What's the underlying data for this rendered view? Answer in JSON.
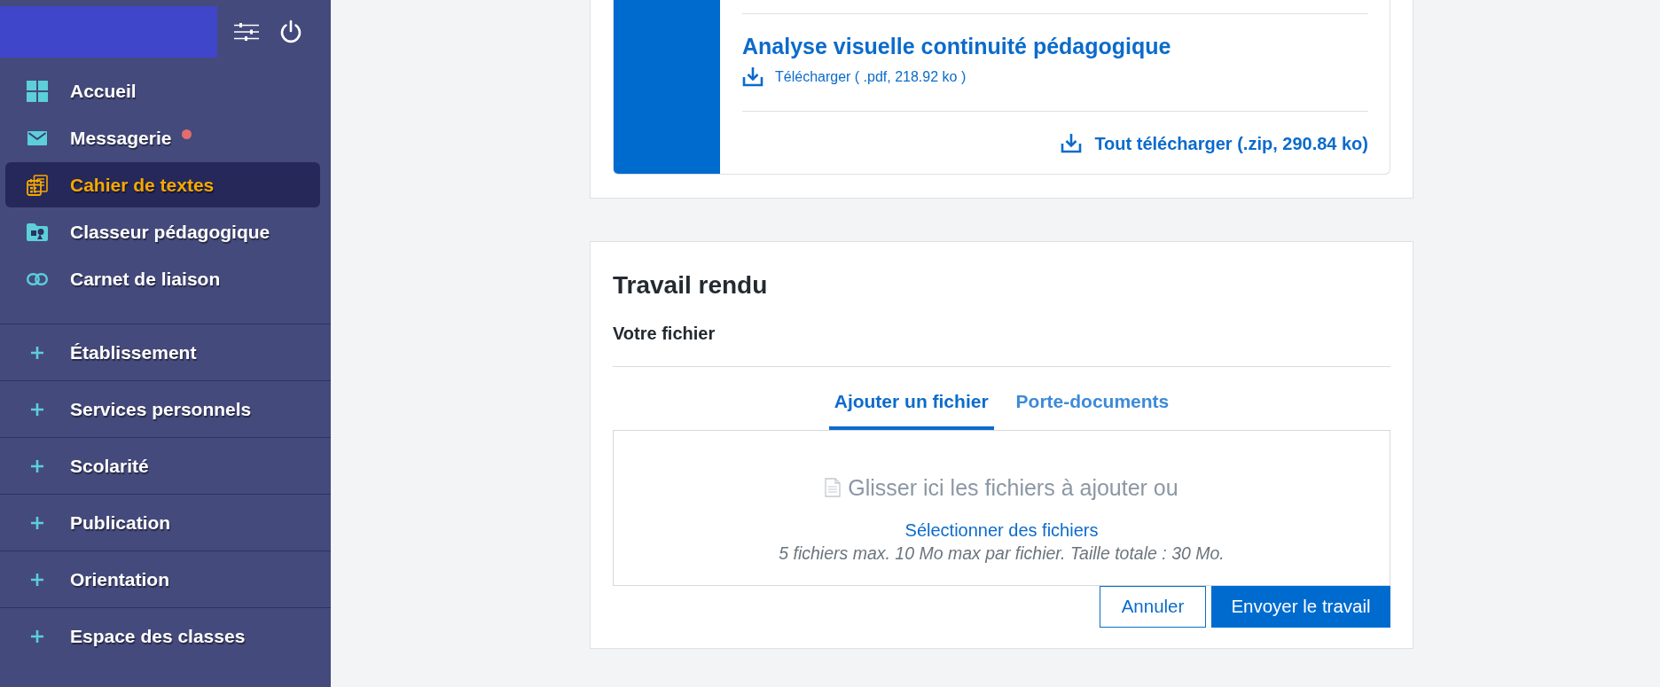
{
  "sidebar": {
    "nav_items": [
      {
        "label": "Accueil",
        "selected": false,
        "notification": false
      },
      {
        "label": "Messagerie",
        "selected": false,
        "notification": true
      },
      {
        "label": "Cahier de textes",
        "selected": true,
        "notification": false
      },
      {
        "label": "Classeur pédagogique",
        "selected": false,
        "notification": false
      },
      {
        "label": "Carnet de liaison",
        "selected": false,
        "notification": false
      }
    ],
    "sections": [
      {
        "label": "Établissement",
        "expanded": false
      },
      {
        "label": "Services personnels",
        "expanded": false
      },
      {
        "label": "Scolarité",
        "expanded": false
      },
      {
        "label": "Publication",
        "expanded": false
      },
      {
        "label": "Orientation",
        "expanded": false
      },
      {
        "label": "Espace des classes",
        "expanded": false
      }
    ]
  },
  "resource_card": {
    "files": [
      {
        "title": "Analyse visuelle continuité pédagogique",
        "download": "Télécharger ( .pdf, 218.92 ko )"
      }
    ],
    "download_all": "Tout télécharger (.zip, 290.84 ko)"
  },
  "submission": {
    "title": "Travail rendu",
    "subtitle": "Votre fichier",
    "tabs": [
      {
        "label": "Ajouter un fichier",
        "selected": true
      },
      {
        "label": "Porte-documents",
        "selected": false
      }
    ],
    "dropzone": {
      "prompt": "Glisser ici les fichiers à ajouter ou",
      "select_link": "Sélectionner des fichiers",
      "limits": "5 fichiers max. 10 Mo max par fichier. Taille totale : 30 Mo."
    },
    "buttons": [
      {
        "label": "Annuler",
        "kind": "secondary"
      },
      {
        "label": "Envoyer le travail",
        "kind": "primary"
      }
    ]
  }
}
